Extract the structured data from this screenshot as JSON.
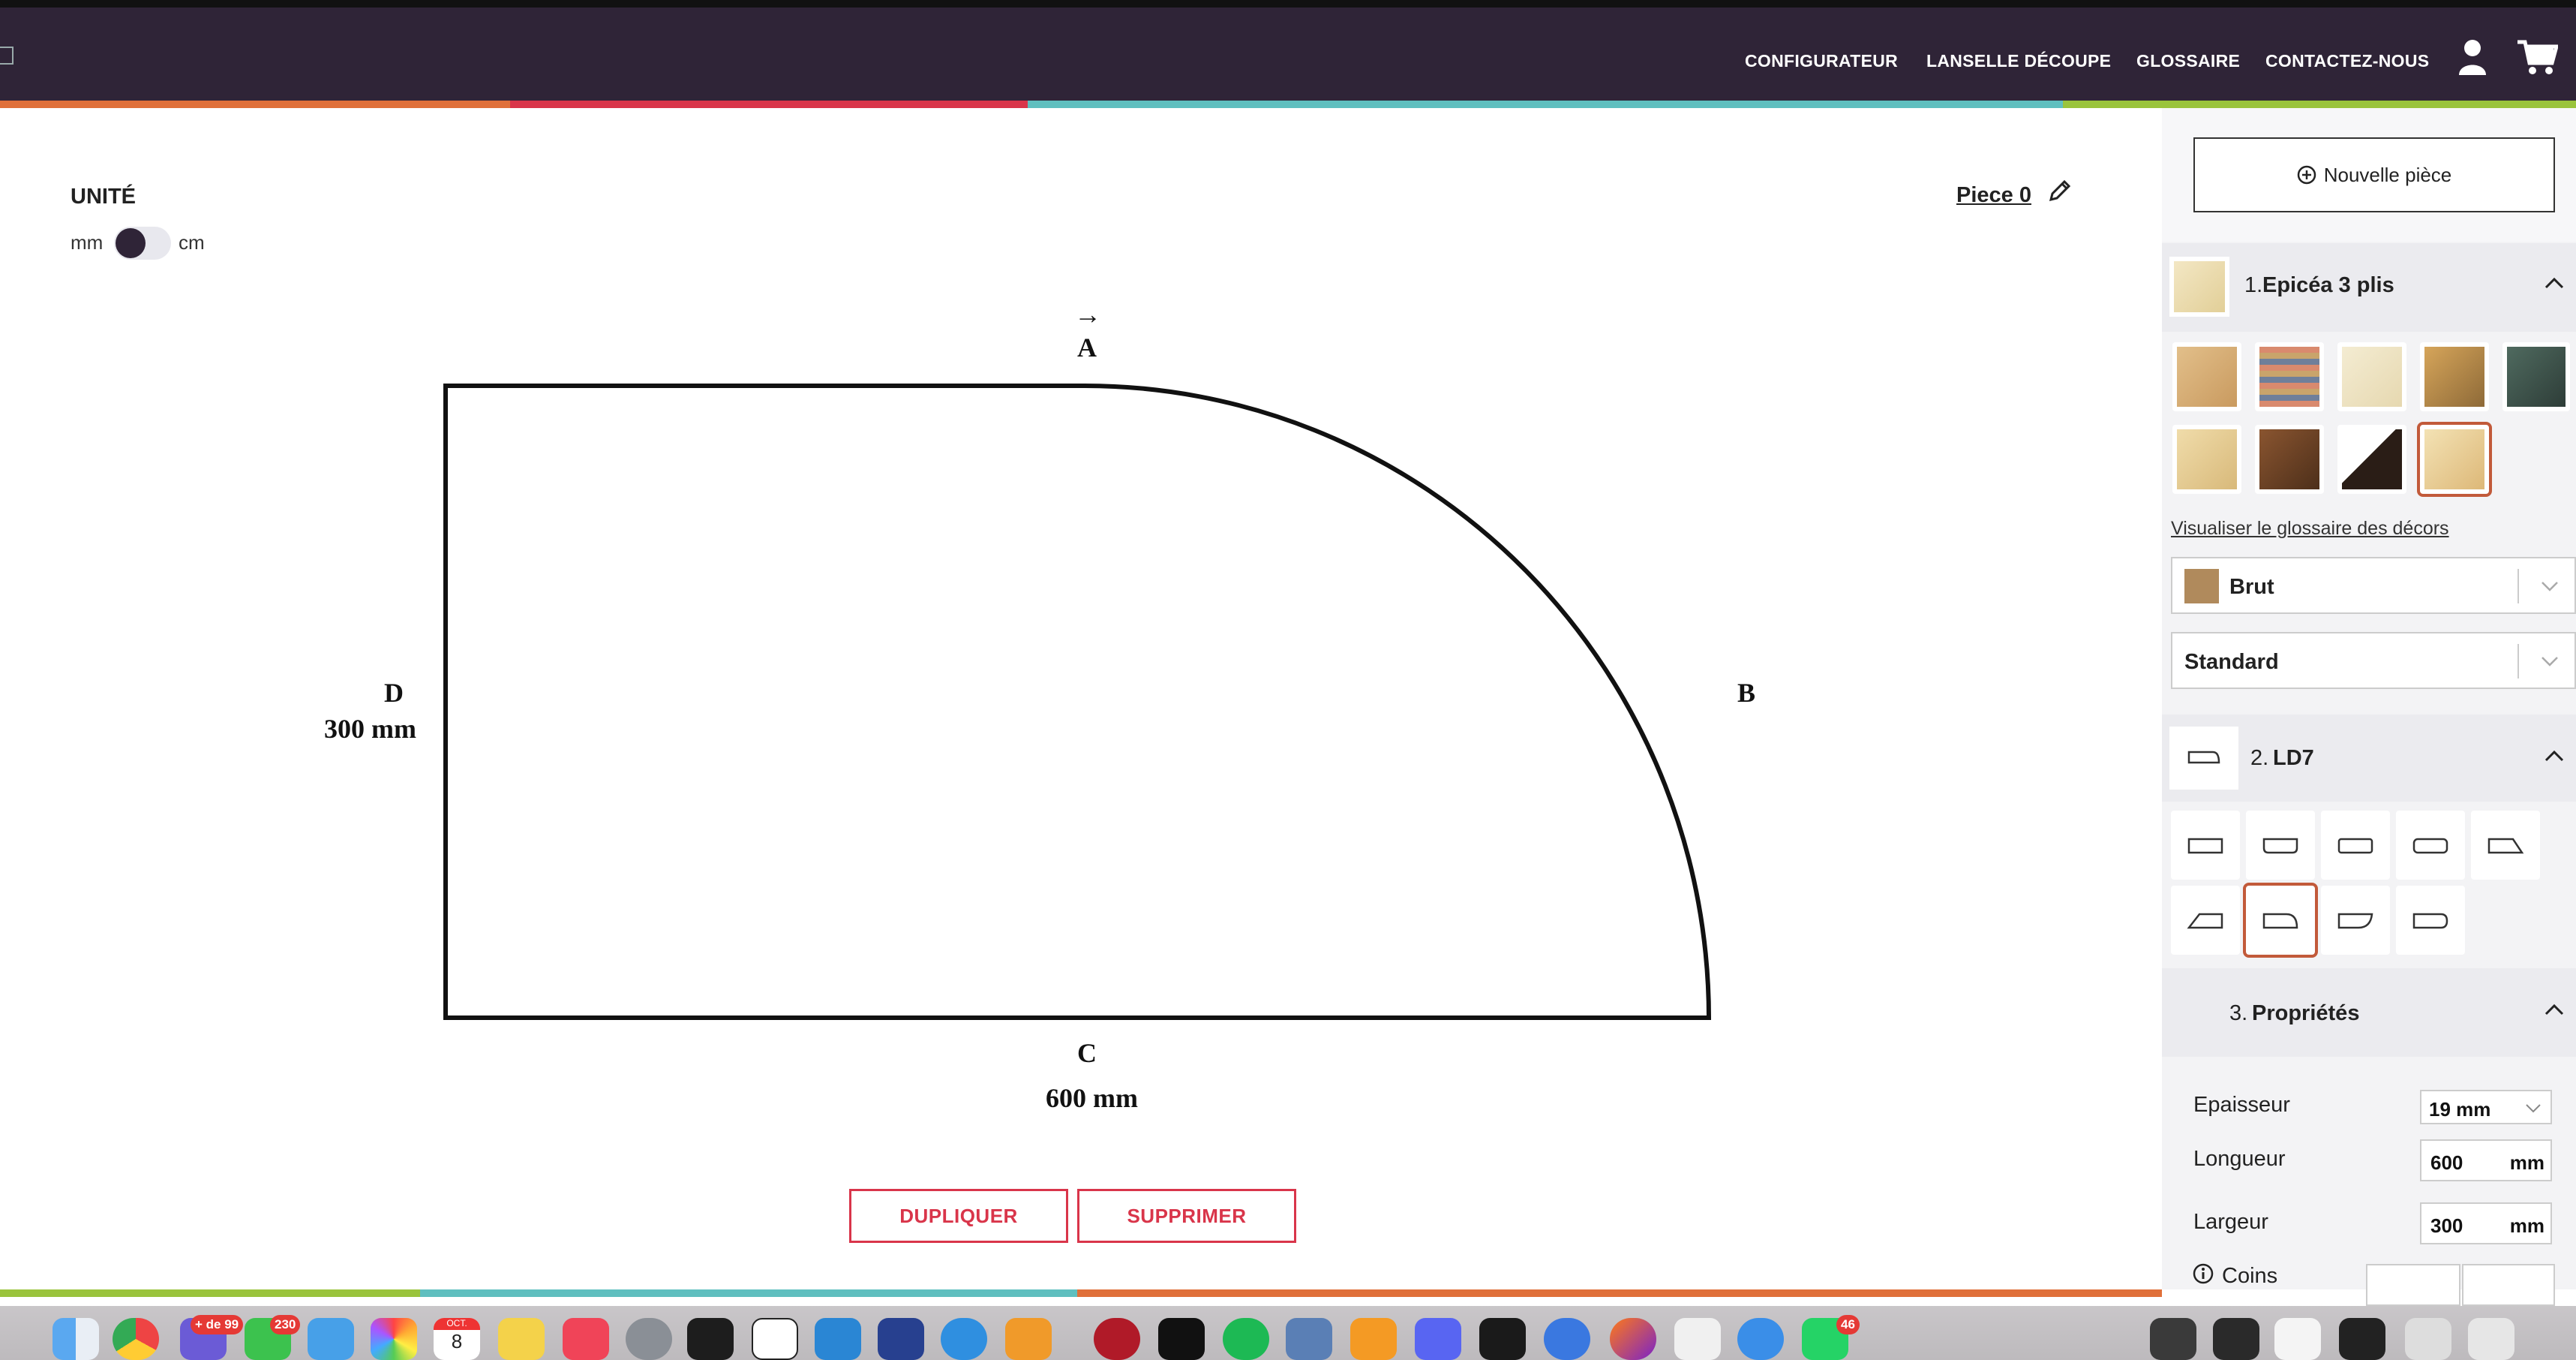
{
  "nav": {
    "links": [
      "CONFIGURATEUR",
      "LANSELLE DÉCOUPE",
      "GLOSSAIRE",
      "CONTACTEZ-NOUS"
    ],
    "user_icon": "user-icon",
    "cart_icon": "cart-icon"
  },
  "brand_colors": {
    "navbar": "#2f2437",
    "accent_red": "#d9354a",
    "accent_teal": "#5fbfbf",
    "accent_green": "#9ac43c",
    "accent_orange": "#e0703a"
  },
  "unit": {
    "title": "UNITÉ",
    "left_label": "mm",
    "right_label": "cm"
  },
  "piece": {
    "name": "Piece 0",
    "edit_icon": "pencil-icon"
  },
  "drawing": {
    "side_a": "A",
    "arrow": "→",
    "side_b": "B",
    "side_c": "C",
    "length": "600 mm",
    "side_d": "D",
    "width": "300 mm"
  },
  "actions": {
    "duplicate": "DUPLIQUER",
    "delete": "SUPPRIMER"
  },
  "panel": {
    "new_piece": "Nouvelle pièce",
    "plus_icon": "plus-circle-icon",
    "section1": {
      "number": "1.",
      "title": "Epicéa 3 plis",
      "chevron": "chevron-up-icon"
    },
    "decor_link": "Visualiser le glossaire des décors",
    "finish_select": "Brut",
    "grade_select": "Standard",
    "section2": {
      "number": "2.",
      "title": "LD7"
    },
    "section3": {
      "number": "3.",
      "title": "Propriétés"
    },
    "properties": {
      "thickness_label": "Epaisseur",
      "thickness_value": "19 mm",
      "length_label": "Longueur",
      "length_value": "600",
      "length_unit": "mm",
      "width_label": "Largeur",
      "width_value": "300",
      "width_unit": "mm",
      "corners_label": "Coins",
      "info_icon": "info-icon"
    }
  },
  "dock": {
    "badges": [
      "+ de 99",
      "230",
      "46"
    ],
    "calendar_month": "OCT.",
    "calendar_day": "8"
  }
}
